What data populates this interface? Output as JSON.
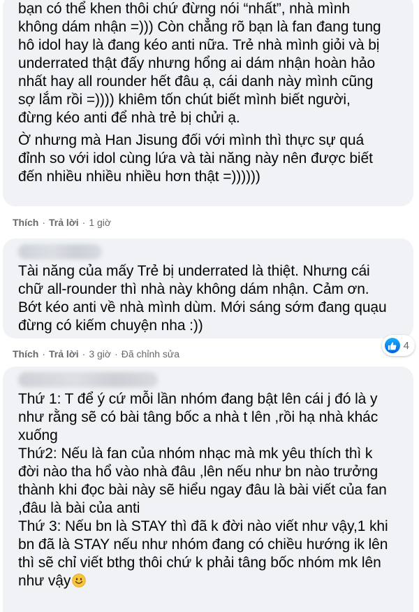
{
  "comment1": {
    "paragraphs": [
      "bạn có thể khen thôi chứ đừng nói “nhất”, nhà mình\nkhông dám nhận =))) Còn chẳng rõ bạn là fan đang tung\nhô idol hay là đang kéo anti nữa. Trẻ nhà mình giỏi và bị\nunderrated thật đấy nhưng hổng ai dám nhận hoàn hảo\nnhất hay all rounder hết đâu ạ, cái danh này mình cũng\nsợ lắm rồi =)))) khiêm tốn chút biết mình biết người,\nđừng kéo anti để nhà trẻ bị chửi ạ.",
      "Ờ nhưng mà Han Jisung đối với mình thì thực sự quá\nđỉnh so với idol cùng lứa và tài năng này nên được biết\nđến nhiều nhiều nhiều hơn thật =))))))"
    ],
    "actions": {
      "like": "Thích",
      "reply": "Trả lời",
      "time": "1 giờ"
    }
  },
  "comment2": {
    "text": "Tài năng của mấy Trẻ bị underrated là thiệt. Nhưng cái\nchữ all-rounder thì nhà này không dám nhận. Cảm ơn.\nBớt kéo anti về nhà mình dùm. Mới sáng sớm đang quạu\nđừng có kiếm chuyện nha :))",
    "actions": {
      "like": "Thích",
      "reply": "Trả lời",
      "time": "3 giờ",
      "edited": "Đã chỉnh sửa"
    },
    "reaction_count": "4",
    "reaction_icon": "like-icon"
  },
  "comment3": {
    "text": "Thứ 1: T để ý cứ mỗi lần nhóm đang bật lên cái j đó là y\nnhư rằng sẽ có bài tâng bốc a nhà t lên ,rồi hạ nhà khác\nxuống\nThứ2: Nếu là fan của nhóm nhạc mà mk yêu thích thì k\nđời nào tha hổ vào nhà đâu ,lên nếu như bn nào trưởng\nthành khi đọc bài này sẽ hiểu ngay đâu là bài viết của fan\n,đâu là bài của anti\nThứ 3: Nếu bn là STAY thì đã k đời nào viết như vậy,1 khi\nbn đã là STAY nếu như nhóm đang có chiều hướng ik lên\nthì sẽ chỉ viết bthg thôi chứ k phải tâng bốc nhóm mk lên\nnhư vậy",
    "emoji": "smiling-face-emoji"
  },
  "colors": {
    "bubble": "#f0f2f5",
    "meta": "#65676b",
    "like_blue": "#0571ed"
  }
}
